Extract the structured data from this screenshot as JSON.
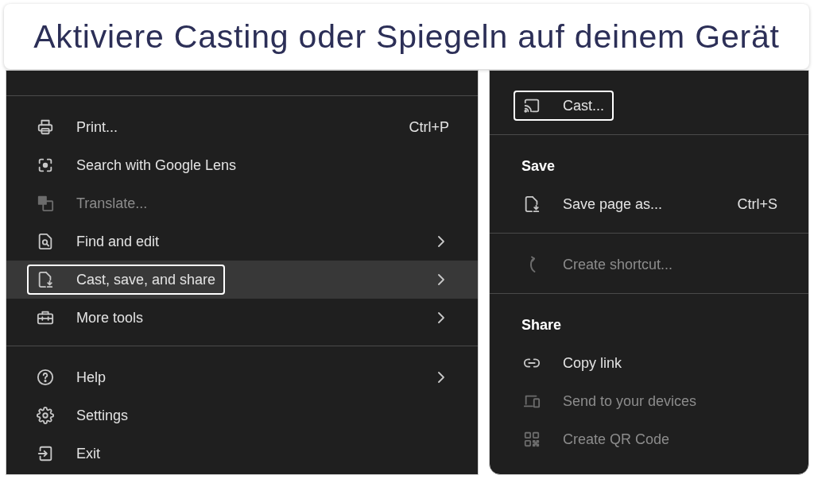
{
  "banner": {
    "title": "Aktiviere Casting oder Spiegeln auf deinem Gerät"
  },
  "main_menu": {
    "sections": [
      {
        "items": [
          {
            "label": "Print...",
            "shortcut": "Ctrl+P",
            "submenu": false,
            "disabled": false,
            "selected": false,
            "outlined": false
          },
          {
            "label": "Search with Google Lens",
            "submenu": false,
            "disabled": false,
            "selected": false,
            "outlined": false
          },
          {
            "label": "Translate...",
            "submenu": false,
            "disabled": true,
            "selected": false,
            "outlined": false
          },
          {
            "label": "Find and edit",
            "submenu": true,
            "disabled": false,
            "selected": false,
            "outlined": false
          },
          {
            "label": "Cast, save, and share",
            "submenu": true,
            "disabled": false,
            "selected": true,
            "outlined": true
          },
          {
            "label": "More tools",
            "submenu": true,
            "disabled": false,
            "selected": false,
            "outlined": false
          }
        ]
      },
      {
        "items": [
          {
            "label": "Help",
            "submenu": true,
            "disabled": false,
            "selected": false,
            "outlined": false
          },
          {
            "label": "Settings",
            "submenu": false,
            "disabled": false,
            "selected": false,
            "outlined": false
          },
          {
            "label": "Exit",
            "submenu": false,
            "disabled": false,
            "selected": false,
            "outlined": false
          }
        ]
      }
    ]
  },
  "cast_save_share_menu": {
    "sections": [
      {
        "items": [
          {
            "label": "Cast...",
            "disabled": false,
            "selected": false,
            "outlined": true
          }
        ]
      },
      {
        "heading": "Save",
        "items": [
          {
            "label": "Save page as...",
            "shortcut": "Ctrl+S",
            "disabled": false,
            "selected": false,
            "outlined": false
          }
        ]
      },
      {
        "items": [
          {
            "label": "Create shortcut...",
            "disabled": true,
            "selected": false,
            "outlined": false
          }
        ]
      },
      {
        "heading": "Share",
        "items": [
          {
            "label": "Copy link",
            "disabled": false,
            "selected": false,
            "outlined": false
          },
          {
            "label": "Send to your devices",
            "disabled": true,
            "selected": false,
            "outlined": false
          },
          {
            "label": "Create QR Code",
            "disabled": true,
            "selected": false,
            "outlined": false
          }
        ]
      }
    ]
  }
}
